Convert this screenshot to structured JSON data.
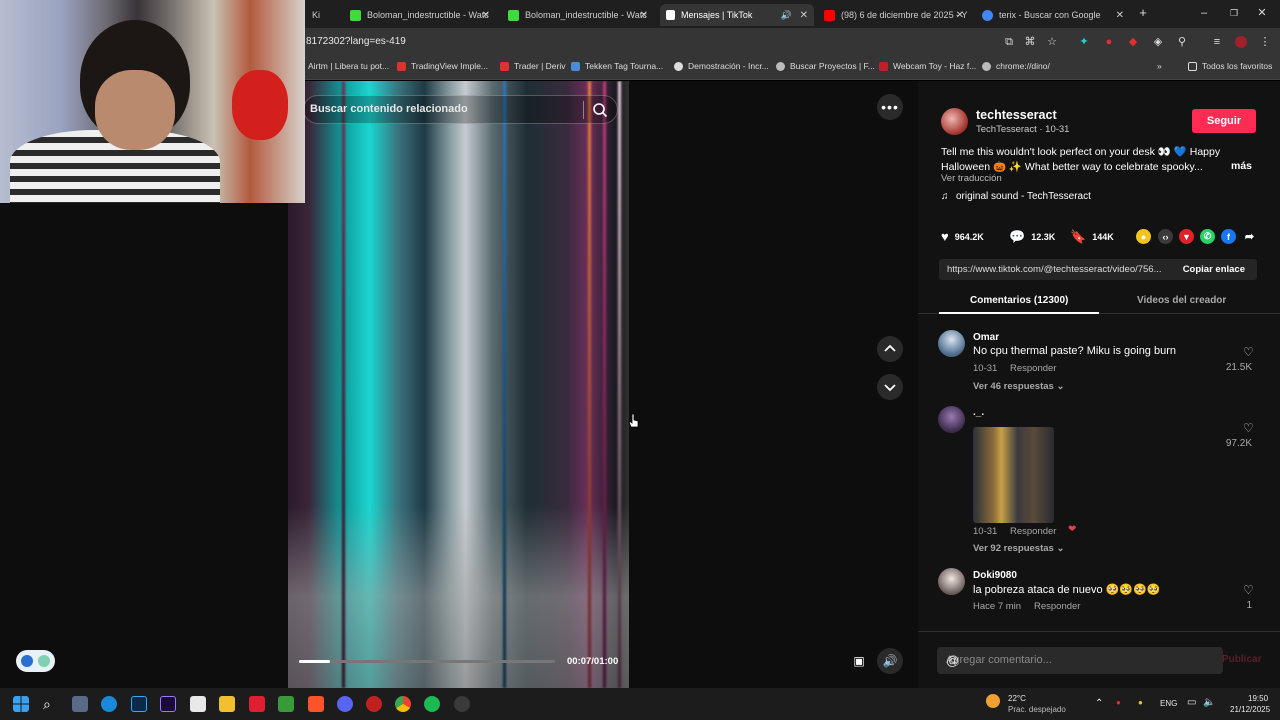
{
  "browser": {
    "tabs": [
      {
        "label": "Ki",
        "active": false
      },
      {
        "label": "Boloman_indestructible - Watc",
        "active": false
      },
      {
        "label": "Boloman_indestructible - Watc",
        "active": false
      },
      {
        "label": "Mensajes | TikTok",
        "active": true
      },
      {
        "label": "(98) 6 de diciembre de 2025 - Y",
        "active": false
      },
      {
        "label": "terix - Buscar con Google",
        "active": false
      }
    ],
    "url": "8172302?lang=es-419",
    "bookmarks": [
      "Airtm | Libera tu pot...",
      "TradingView Imple...",
      "Trader | Deriv",
      "Tekken Tag Tourna...",
      "Demostración - Incr...",
      "Buscar Proyectos | F...",
      "Webcam Toy - Haz f...",
      "chrome://dino/"
    ],
    "all_bookmarks": "Todos los favoritos"
  },
  "player": {
    "search_placeholder": "Buscar contenido relacionado",
    "timecode": "00:07/01:00",
    "progress": 0.12
  },
  "post": {
    "username": "techtesseract",
    "subtitle": "TechTesseract · 10-31",
    "follow": "Seguir",
    "description": "Tell me this wouldn't look perfect on your desk 👀 💙 Happy Halloween 🎃 ✨ What better way to celebrate spooky...",
    "more": "más",
    "translate": "Ver traducción",
    "sound": "original sound - TechTesseract",
    "likes": "964.2K",
    "comments": "12.3K",
    "saves": "144K",
    "link": "https://www.tiktok.com/@techtesseract/video/756...",
    "copy_link": "Copiar enlace"
  },
  "tabs": {
    "comments": "Comentarios (12300)",
    "creator_videos": "Videos del creador"
  },
  "comments": [
    {
      "user": "Omar",
      "text": "No cpu thermal paste? Miku is going burn",
      "date": "10-31",
      "reply": "Responder",
      "replies": "Ver 46 respuestas",
      "likes": "21.5K"
    },
    {
      "user": "._.",
      "text": "",
      "date": "10-31",
      "reply": "Responder",
      "replies": "Ver 92 respuestas",
      "likes": "97.2K"
    },
    {
      "user": "Doki9080",
      "text": "la pobreza ataca de nuevo 🥺🥺🥺🥺",
      "date": "Hace 7 min",
      "reply": "Responder",
      "replies": "",
      "likes": "1"
    }
  ],
  "comment_input": {
    "placeholder": "Agregar comentario...",
    "post": "Publicar"
  },
  "taskbar": {
    "temp": "22°C",
    "weather": "Prac. despejado",
    "lang": "ENG",
    "time": "19:50",
    "date": "21/12/2025"
  },
  "colors": {
    "accent": "#fe2c55",
    "background": "#121212"
  }
}
